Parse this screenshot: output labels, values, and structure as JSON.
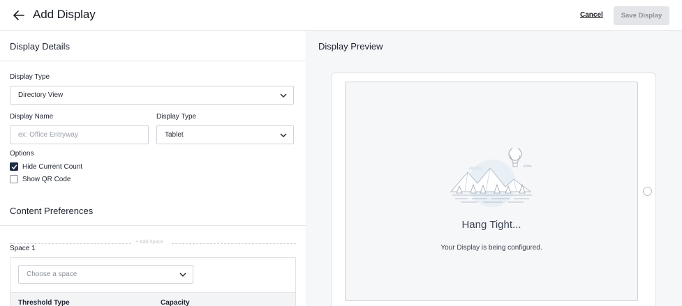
{
  "header": {
    "back_icon": "arrow-left-icon",
    "title": "Add Display",
    "cancel_label": "Cancel",
    "save_label": "Save Display"
  },
  "display_details": {
    "heading": "Display Details",
    "display_type_label": "Display Type",
    "display_type_value": "Directory View",
    "display_name_label": "Display Name",
    "display_name_placeholder": "ex: Office Entryway",
    "display_name_value": "",
    "device_type_label": "Display Type",
    "device_type_value": "Tablet",
    "options_label": "Options",
    "options": [
      {
        "label": "Hide Current Count",
        "checked": true
      },
      {
        "label": "Show QR Code",
        "checked": false
      }
    ]
  },
  "content_preferences": {
    "heading": "Content Preferences",
    "add_space_label": "+ Add Space",
    "space_title": "Space 1",
    "space_placeholder": "Choose a space",
    "columns": [
      "Threshold Type",
      "Capacity"
    ]
  },
  "preview": {
    "heading": "Display Preview",
    "status_title": "Hang Tight...",
    "status_message": "Your Display is being configured."
  },
  "colors": {
    "checkbox_checked": "#1f2a44",
    "save_disabled_bg": "#e3e5e8",
    "preview_bg": "#f6f7f9"
  }
}
